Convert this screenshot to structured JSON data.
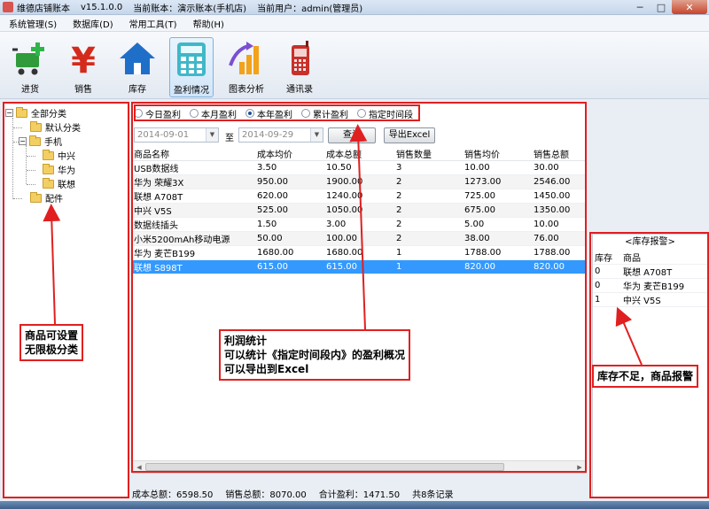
{
  "window": {
    "title_parts": [
      "维德店铺账本",
      "v15.1.0.0",
      "当前账本：演示账本(手机店)",
      "当前用户：admin(管理员)"
    ],
    "min": "─",
    "max": "□",
    "close": "✕"
  },
  "menu": [
    "系统管理(S)",
    "数据库(D)",
    "常用工具(T)",
    "帮助(H)"
  ],
  "toolbar": [
    {
      "label": "进货",
      "icon": "cart-add-icon"
    },
    {
      "label": "销售",
      "icon": "yen-icon"
    },
    {
      "label": "库存",
      "icon": "house-icon"
    },
    {
      "label": "盈利情况",
      "icon": "calculator-icon"
    },
    {
      "label": "图表分析",
      "icon": "bar-chart-icon"
    },
    {
      "label": "通讯录",
      "icon": "phone-icon"
    }
  ],
  "tree": {
    "root": "全部分类",
    "items": [
      "默认分类",
      "手机",
      "中兴",
      "华为",
      "联想",
      "配件"
    ]
  },
  "filters": {
    "options": [
      "今日盈利",
      "本月盈利",
      "本年盈利",
      "累计盈利",
      "指定时间段"
    ],
    "selected": "本年盈利",
    "date_from": "2014-09-01",
    "date_to": "2014-09-29",
    "to_label": "至",
    "query_button": "查询",
    "export_button": "导出Excel"
  },
  "table": {
    "headers": [
      "商品名称",
      "成本均价",
      "成本总额",
      "销售数量",
      "销售均价",
      "销售总额"
    ],
    "rows": [
      [
        "USB数据线",
        "3.50",
        "10.50",
        "3",
        "10.00",
        "30.00"
      ],
      [
        "华为 荣耀3X",
        "950.00",
        "1900.00",
        "2",
        "1273.00",
        "2546.00"
      ],
      [
        "联想 A708T",
        "620.00",
        "1240.00",
        "2",
        "725.00",
        "1450.00"
      ],
      [
        "中兴 V5S",
        "525.00",
        "1050.00",
        "2",
        "675.00",
        "1350.00"
      ],
      [
        "数据线插头",
        "1.50",
        "3.00",
        "2",
        "5.00",
        "10.00"
      ],
      [
        "小米5200mAh移动电源",
        "50.00",
        "100.00",
        "2",
        "38.00",
        "76.00"
      ],
      [
        "华为 麦芒B199",
        "1680.00",
        "1680.00",
        "1",
        "1788.00",
        "1788.00"
      ],
      [
        "联想 S898T",
        "615.00",
        "615.00",
        "1",
        "820.00",
        "820.00"
      ]
    ],
    "selected_row": 7
  },
  "status": {
    "cost_total": "成本总额：6598.50",
    "sales_total": "销售总额：8070.00",
    "profit_total": "合计盈利：1471.50",
    "record_count": "共8条记录"
  },
  "stock_alert": {
    "title": "<库存报警>",
    "headers": [
      "库存",
      "商品"
    ],
    "rows": [
      [
        "0",
        "联想 A708T"
      ],
      [
        "0",
        "华为 麦芒B199"
      ],
      [
        "1",
        "中兴 V5S"
      ]
    ]
  },
  "annotations": {
    "category_note": [
      "商品可设置",
      "无限极分类"
    ],
    "profit_note": [
      "利润统计",
      "可以统计《指定时间段内》的盈利概况",
      "可以导出到Excel"
    ],
    "stock_note": "库存不足，商品报警"
  },
  "colors": {
    "annotation_red": "#e02020",
    "selection_blue": "#3399ff",
    "titlebar": "#c6d6ea"
  }
}
